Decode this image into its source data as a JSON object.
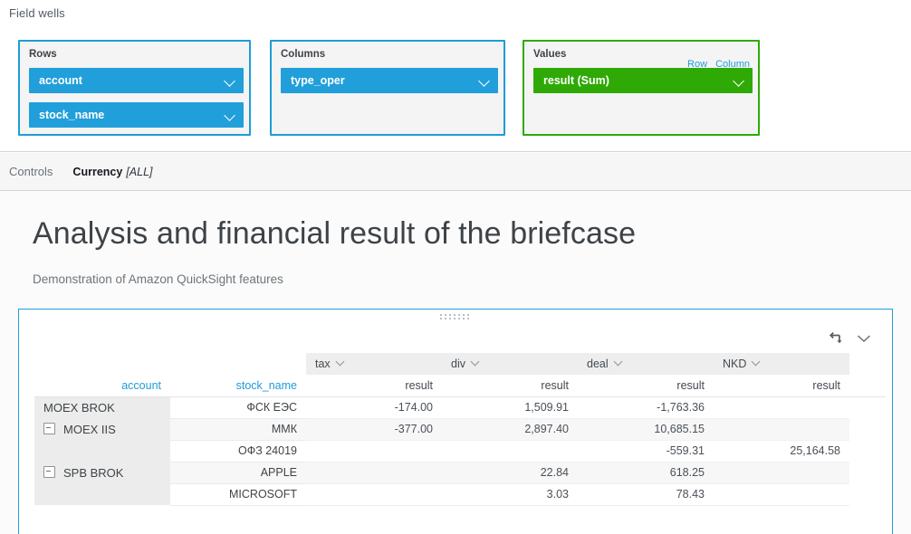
{
  "fieldwells": {
    "title": "Field wells",
    "wells": [
      {
        "label": "Rows",
        "color": "#1f9cd7",
        "fields": [
          {
            "label": "account"
          },
          {
            "label": "stock_name"
          }
        ]
      },
      {
        "label": "Columns",
        "color": "#1f9cd7",
        "fields": [
          {
            "label": "type_oper"
          }
        ]
      },
      {
        "label": "Values",
        "color": "#2fa906",
        "links": [
          {
            "label": "Row",
            "active": false
          },
          {
            "label": "Column",
            "active": true
          }
        ],
        "fields": [
          {
            "label": "result (Sum)"
          }
        ]
      }
    ]
  },
  "controls": {
    "label": "Controls",
    "items": [
      {
        "name": "Currency",
        "value": "[ALL]"
      }
    ]
  },
  "sheet": {
    "title": "Analysis and financial result of the briefcase",
    "subtitle": "Demonstration of Amazon QuickSight features"
  },
  "visual": {
    "actions": [
      {
        "icon": "transpose-icon"
      },
      {
        "icon": "chevron-down-icon"
      }
    ],
    "row_headers": [
      {
        "label": "account"
      },
      {
        "label": "stock_name"
      }
    ],
    "column_groups": [
      {
        "label": "tax"
      },
      {
        "label": "div"
      },
      {
        "label": "deal"
      },
      {
        "label": "NKD"
      }
    ],
    "metric_label": "result",
    "rows": [
      {
        "account": "MOEX BROK",
        "collapsible": false,
        "stock_name": "ФСК ЕЭС",
        "values": [
          "-174.00",
          "1,509.91",
          "-1,763.36",
          ""
        ]
      },
      {
        "account": "MOEX IIS",
        "collapsible": true,
        "stock_name": "ММК",
        "values": [
          "-377.00",
          "2,897.40",
          "10,685.15",
          ""
        ]
      },
      {
        "account": "",
        "collapsible": false,
        "stock_name": "ОФЗ 24019",
        "values": [
          "",
          "",
          "-559.31",
          "25,164.58"
        ]
      },
      {
        "account": "SPB BROK",
        "collapsible": true,
        "stock_name": "APPLE",
        "values": [
          "",
          "22.84",
          "618.25",
          ""
        ]
      },
      {
        "account": "",
        "collapsible": false,
        "stock_name": "MICROSOFT",
        "values": [
          "",
          "3.03",
          "78.43",
          ""
        ]
      }
    ]
  },
  "colors": {
    "blue": "#1f9cd7",
    "green": "#2fa906",
    "pill_blue": "#219fda",
    "header_gray": "#eeeeee",
    "row_alt": "#f7f7f7"
  }
}
